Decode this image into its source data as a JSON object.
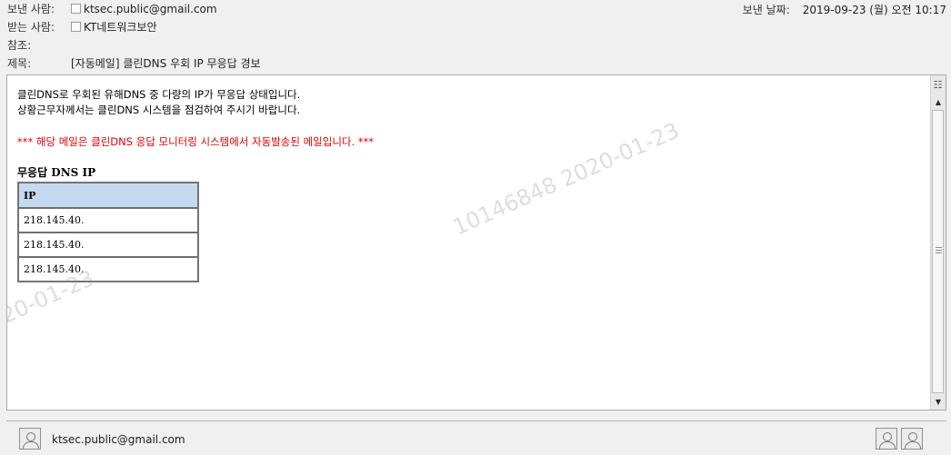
{
  "header": {
    "from_label": "보낸 사람:",
    "from_value": "ktsec.public@gmail.com",
    "to_label": "받는 사람:",
    "to_value": "KT네트워크보안",
    "cc_label": "참조:",
    "subject_label": "제목:",
    "subject_value": "[자동메일] 클린DNS 우회 IP 무응답 경보",
    "sent_label": "보낸 날짜:",
    "sent_value": "2019-09-23 (월) 오전 10:17"
  },
  "message": {
    "line1": "클린DNS로 우회된 유해DNS 중 다량의 IP가 무응답 상태입니다.",
    "line2": "상황근무자께서는 클린DNS 시스템을 점검하여 주시기 바랍니다.",
    "alert": "*** 해당 메일은 클린DNS 응답 모니터링 시스템에서 자동발송된 메일입니다. ***",
    "table_title": "무응답 DNS IP",
    "table_header": "IP",
    "rows": [
      "218.145.40.",
      "218.145.40.",
      "218.145.40."
    ]
  },
  "watermark": {
    "text1": "10146848  2020-01-23",
    "text2": "20-01-23"
  },
  "footer": {
    "email": "ktsec.public@gmail.com"
  },
  "colors": {
    "alert": "#e00000",
    "table_header_bg": "#c5d9f1"
  },
  "icons": [
    "person-icon",
    "scroll-up-arrow",
    "scroll-down-arrow",
    "avatar-icon"
  ]
}
